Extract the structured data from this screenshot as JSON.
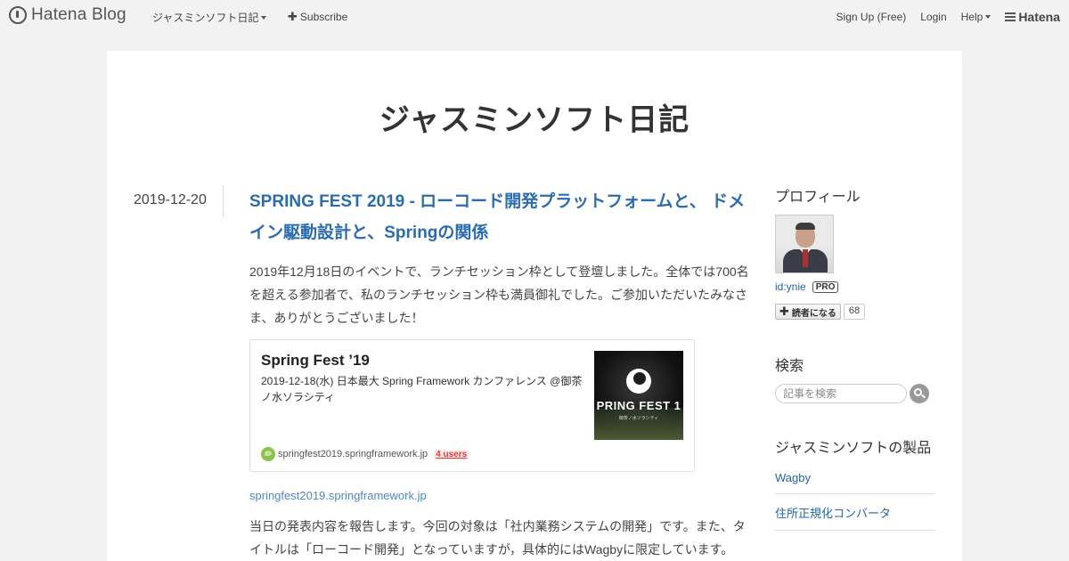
{
  "globalbar": {
    "logo_text": "Hatena Blog",
    "blog_menu_label": "ジャスミンソフト日記",
    "subscribe_label": "Subscribe",
    "signup_label": "Sign Up (Free)",
    "login_label": "Login",
    "help_label": "Help",
    "hatena_label": "Hatena"
  },
  "blog": {
    "title": "ジャスミンソフト日記"
  },
  "entry": {
    "date": "2019-12-20",
    "title": "SPRING FEST 2019 - ローコード開発プラットフォームと、 ドメイン駆動設計と、Springの関係",
    "paragraph1": "2019年12月18日のイベントで、ランチセッション枠として登壇しました。全体では700名を超える参加者で、私のランチセッション枠も満員御礼でした。ご参加いただいたみなさま、ありがとうございました！",
    "card": {
      "title": "Spring Fest ’19",
      "description": "2019-12-18(水) 日本最大 Spring Framework カンファレンス @御茶ノ水ソラシティ",
      "thumb_text": "PRING FEST 1",
      "thumb_subtext": "御茶ノ水ソラシティ",
      "domain": "springfest2019.springframework.jp",
      "users": "4 users"
    },
    "source_link": "springfest2019.springframework.jp",
    "paragraph2": "当日の発表内容を報告します。今回の対象は「社内業務システムの開発」です。また、タイトルは「ローコード開発」となっていますが，具体的にはWagbyに限定しています。"
  },
  "sidebar": {
    "profile_heading": "プロフィール",
    "user_id": "id:ynie",
    "pro_badge": "PRO",
    "follow_label": "読者になる",
    "follower_count": "68",
    "search_heading": "検索",
    "search_placeholder": "記事を検索",
    "products_heading": "ジャスミンソフトの製品",
    "products": [
      "Wagby",
      "住所正規化コンバータ"
    ]
  }
}
